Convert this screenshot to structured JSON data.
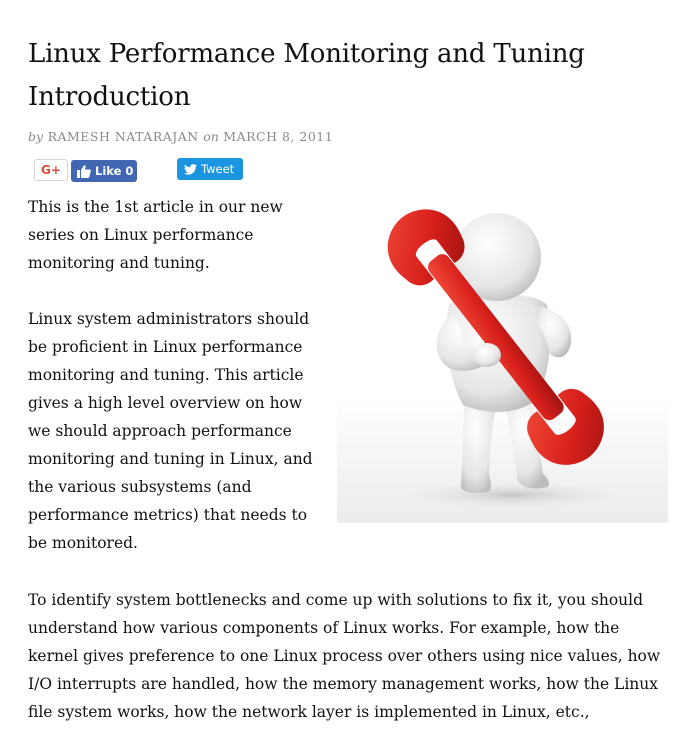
{
  "article": {
    "title": "Linux Performance Monitoring and Tuning Introduction",
    "byline": {
      "by": "by",
      "author": "RAMESH NATARAJAN",
      "on": "on",
      "date": "MARCH 8, 2011"
    }
  },
  "share": {
    "google_plus_label": "G+",
    "like_label": "Like 0",
    "tweet_label": "Tweet"
  },
  "figure": {
    "alt": "3D white figure holding a red wrench"
  },
  "body": {
    "paragraph_1": "This is the 1st article in our new series on Linux performance monitoring and tuning.",
    "paragraph_2": "Linux system administrators should be proficient in Linux performance monitoring and tuning. This article gives a high level overview on how we should approach performance monitoring and tuning in Linux, and the various subsystems (and performance metrics) that needs to be monitored.",
    "paragraph_3": "To identify system bottlenecks and come up with solutions to fix it, you should understand how various components of Linux works. For example, how the kernel gives preference to one Linux process over others using nice values, how I/O interrupts are handled, how the memory management works, how the Linux file system works, how the network layer is implemented in Linux, etc.,"
  },
  "colors": {
    "google_red": "#dd4b39",
    "facebook_blue": "#4267b2",
    "twitter_blue": "#1b95e0",
    "wrench_red": "#d8201c"
  }
}
